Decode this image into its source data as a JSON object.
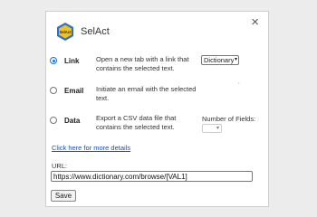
{
  "app": {
    "title": "SelAct",
    "logo_text": "SelAct"
  },
  "close_symbol": "×",
  "options": [
    {
      "label": "Link",
      "description": "Open a new tab with a link that contains the selected text.",
      "checked": true
    },
    {
      "label": "Email",
      "description": "Initiate an email with the selected text.",
      "checked": false
    },
    {
      "label": "Data",
      "description": "Export a CSV data file that contains the selected text.",
      "checked": false
    }
  ],
  "link_select": {
    "selected": "Dictionary"
  },
  "data_fields": {
    "label": "Number of Fields:",
    "selected": ""
  },
  "details_link": "Click here for more details",
  "url": {
    "label": "URL:",
    "value": "https://www.dictionary.com/browse/[VAL1]"
  },
  "save_label": "Save",
  "colors": {
    "accent": "#1a73e8",
    "logo_blue": "#2a6fd6",
    "logo_yellow": "#f2c21b",
    "link": "#1a4fb5"
  }
}
